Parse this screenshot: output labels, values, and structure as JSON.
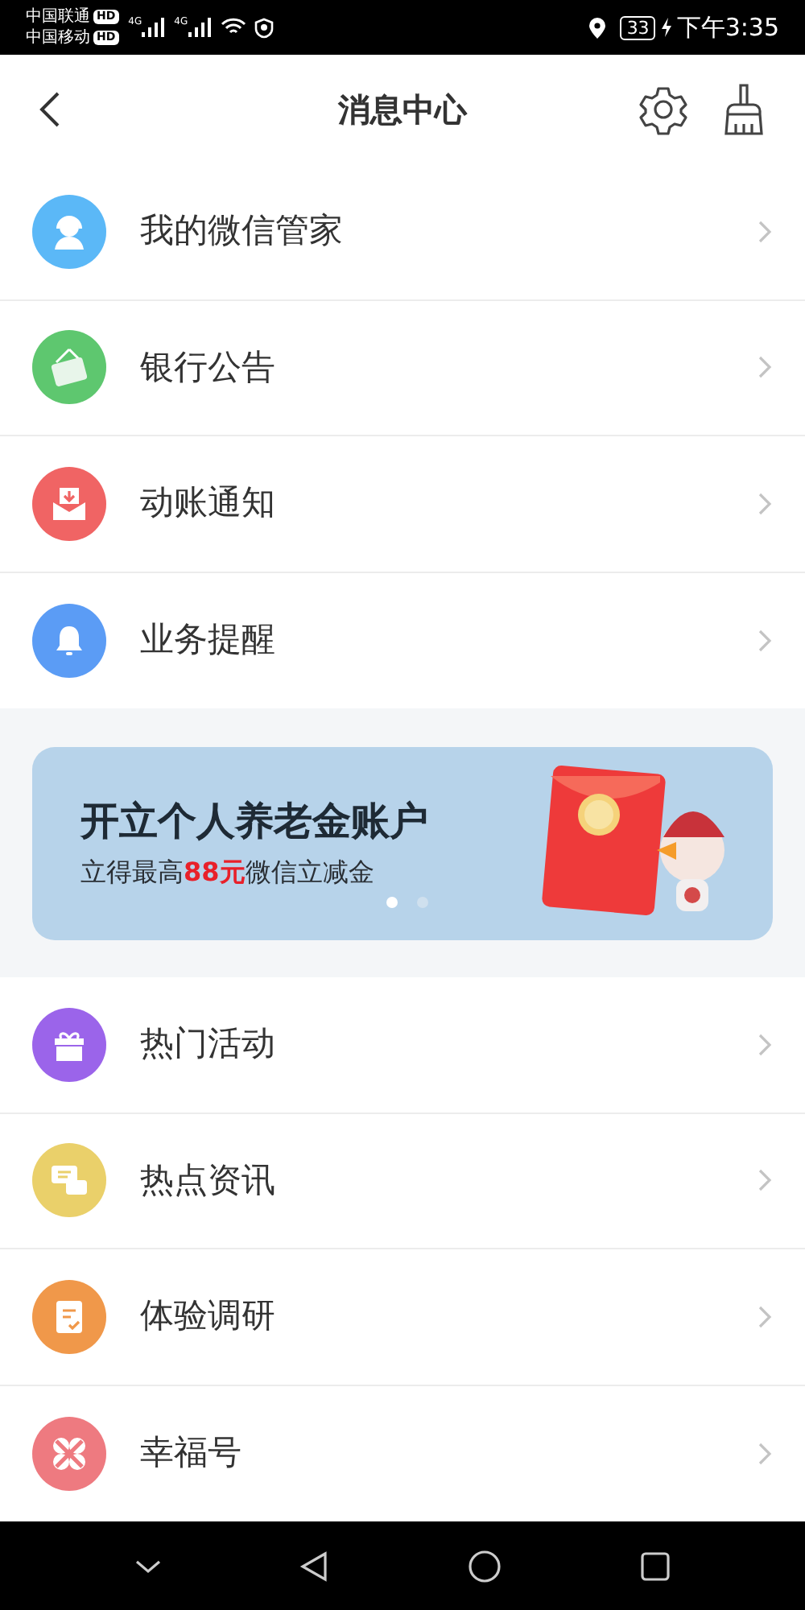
{
  "status_bar": {
    "carriers": [
      {
        "name": "中国联通",
        "badge": "HD"
      },
      {
        "name": "中国移动",
        "badge": "HD"
      }
    ],
    "networks": [
      "4G",
      "4G"
    ],
    "battery": "33",
    "time": "下午3:35"
  },
  "header": {
    "title": "消息中心"
  },
  "top_items": [
    {
      "label": "我的微信管家",
      "kind": "headset",
      "color": "#5bb8f7"
    },
    {
      "label": "银行公告",
      "kind": "sign",
      "color": "#5ec76f"
    },
    {
      "label": "动账通知",
      "kind": "inbox",
      "color": "#f06464"
    },
    {
      "label": "业务提醒",
      "kind": "bell",
      "color": "#5b9cf5"
    }
  ],
  "banner": {
    "title": "开立个人养老金账户",
    "subtitle": "立得最高**88元**微信立减金",
    "dots": [
      {
        "selected": true
      },
      {
        "selected": false
      }
    ]
  },
  "bottom_items": [
    {
      "label": "热门活动",
      "kind": "gift",
      "color": "#9b64ea"
    },
    {
      "label": "热点资讯",
      "kind": "chat",
      "color": "#ead06a"
    },
    {
      "label": "体验调研",
      "kind": "clipboard",
      "color": "#f0984a"
    },
    {
      "label": "幸福号",
      "kind": "clover",
      "color": "#ee7a80"
    }
  ]
}
